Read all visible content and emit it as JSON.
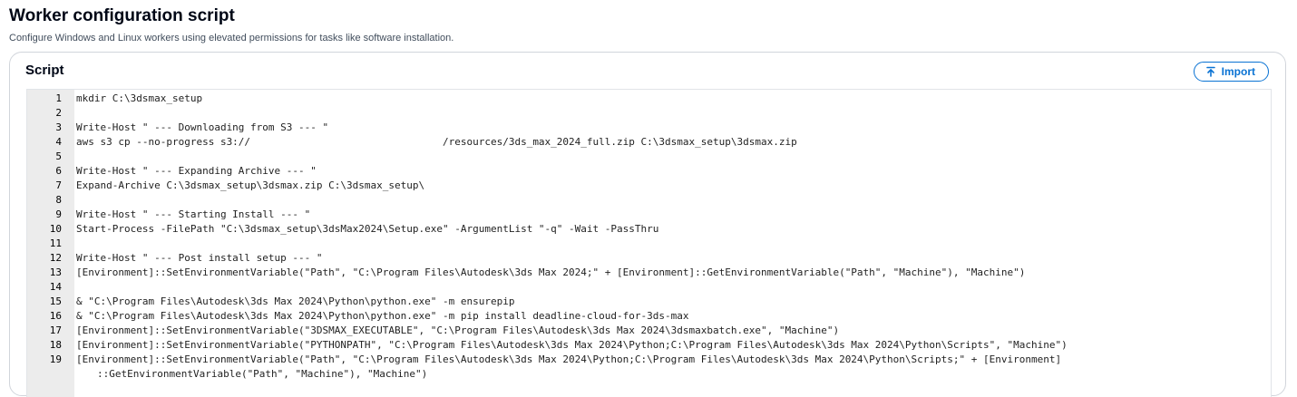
{
  "page": {
    "title": "Worker configuration script",
    "description": "Configure Windows and Linux workers using elevated permissions for tasks like software installation."
  },
  "script_panel": {
    "title": "Script",
    "import_label": "Import"
  },
  "editor": {
    "lines": [
      {
        "n": "1",
        "text": "mkdir C:\\3dsmax_setup"
      },
      {
        "n": "2",
        "text": ""
      },
      {
        "n": "3",
        "text": "Write-Host \" --- Downloading from S3 --- \""
      },
      {
        "n": "4",
        "text": "aws s3 cp --no-progress s3://                                /resources/3ds_max_2024_full.zip C:\\3dsmax_setup\\3dsmax.zip"
      },
      {
        "n": "5",
        "text": ""
      },
      {
        "n": "6",
        "text": "Write-Host \" --- Expanding Archive --- \""
      },
      {
        "n": "7",
        "text": "Expand-Archive C:\\3dsmax_setup\\3dsmax.zip C:\\3dsmax_setup\\"
      },
      {
        "n": "8",
        "text": ""
      },
      {
        "n": "9",
        "text": "Write-Host \" --- Starting Install --- \""
      },
      {
        "n": "10",
        "text": "Start-Process -FilePath \"C:\\3dsmax_setup\\3dsMax2024\\Setup.exe\" -ArgumentList \"-q\" -Wait -PassThru"
      },
      {
        "n": "11",
        "text": ""
      },
      {
        "n": "12",
        "text": "Write-Host \" --- Post install setup --- \""
      },
      {
        "n": "13",
        "text": "[Environment]::SetEnvironmentVariable(\"Path\", \"C:\\Program Files\\Autodesk\\3ds Max 2024;\" + [Environment]::GetEnvironmentVariable(\"Path\", \"Machine\"), \"Machine\")"
      },
      {
        "n": "14",
        "text": ""
      },
      {
        "n": "15",
        "text": "& \"C:\\Program Files\\Autodesk\\3ds Max 2024\\Python\\python.exe\" -m ensurepip"
      },
      {
        "n": "16",
        "text": "& \"C:\\Program Files\\Autodesk\\3ds Max 2024\\Python\\python.exe\" -m pip install deadline-cloud-for-3ds-max"
      },
      {
        "n": "17",
        "text": "[Environment]::SetEnvironmentVariable(\"3DSMAX_EXECUTABLE\", \"C:\\Program Files\\Autodesk\\3ds Max 2024\\3dsmaxbatch.exe\", \"Machine\")"
      },
      {
        "n": "18",
        "text": "[Environment]::SetEnvironmentVariable(\"PYTHONPATH\", \"C:\\Program Files\\Autodesk\\3ds Max 2024\\Python;C:\\Program Files\\Autodesk\\3ds Max 2024\\Python\\Scripts\", \"Machine\")"
      },
      {
        "n": "19",
        "text": "[Environment]::SetEnvironmentVariable(\"Path\", \"C:\\Program Files\\Autodesk\\3ds Max 2024\\Python;C:\\Program Files\\Autodesk\\3ds Max 2024\\Python\\Scripts;\" + [Environment]"
      },
      {
        "n": "",
        "text": "::GetEnvironmentVariable(\"Path\", \"Machine\"), \"Machine\")",
        "continuation": true
      }
    ]
  },
  "colors": {
    "accent": "#0972d3",
    "gutter": "#ececec",
    "border": "#d1d5db"
  }
}
